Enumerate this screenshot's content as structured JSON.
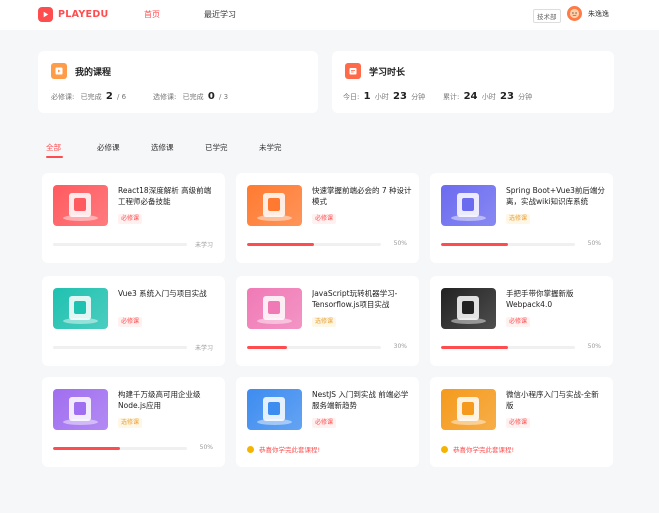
{
  "header": {
    "brand": "PLAYEDU",
    "nav": [
      {
        "label": "首页",
        "active": true
      },
      {
        "label": "最近学习",
        "active": false
      }
    ],
    "department": "技术部",
    "username": "朱逸逸"
  },
  "stats": {
    "my_courses": {
      "title": "我的课程",
      "required_label": "必修课:",
      "required_done_label": "已完成",
      "required_done": "2",
      "required_total": "/ 6",
      "elective_label": "选修课:",
      "elective_done_label": "已完成",
      "elective_done": "0",
      "elective_total": "/ 3"
    },
    "study_time": {
      "title": "学习时长",
      "today_label": "今日:",
      "today_hours": "1",
      "today_minutes": "23",
      "total_label": "累计:",
      "total_hours": "24",
      "total_minutes": "23",
      "hour_unit": "小时",
      "minute_unit": "分钟"
    }
  },
  "tabs": [
    {
      "label": "全部",
      "active": true
    },
    {
      "label": "必修课",
      "active": false
    },
    {
      "label": "选修课",
      "active": false
    },
    {
      "label": "已学完",
      "active": false
    },
    {
      "label": "未学完",
      "active": false
    }
  ],
  "courses": [
    {
      "title": "React18深度解析 高级前端工程师必备技能",
      "tag": "必修课",
      "tag_type": "req",
      "progress": 0,
      "status": "未学习",
      "color": "#ff5a5f"
    },
    {
      "title": "快速掌握前端必会的 7 种设计模式",
      "tag": "必修课",
      "tag_type": "req",
      "progress": 0.5,
      "status": "50%",
      "color": "#ff7a30"
    },
    {
      "title": "Spring Boot+Vue3前后端分离，实战wiki知识库系统",
      "tag": "选修课",
      "tag_type": "opt",
      "progress": 0.5,
      "status": "50%",
      "color": "#6b6bf0"
    },
    {
      "title": "Vue3 系统入门与项目实战",
      "tag": "必修课",
      "tag_type": "req",
      "progress": 0,
      "status": "未学习",
      "color": "#1fc1b0"
    },
    {
      "title": "JavaScript玩转机器学习-Tensorflow.js项目实战",
      "tag": "选修课",
      "tag_type": "opt",
      "progress": 0.3,
      "status": "30%",
      "color": "#f07ab6"
    },
    {
      "title": "手把手带你掌握新版Webpack4.0",
      "tag": "必修课",
      "tag_type": "req",
      "progress": 0.5,
      "status": "50%",
      "color": "#222222"
    },
    {
      "title": "构建千万级高可用企业级Node.js应用",
      "tag": "选修课",
      "tag_type": "opt",
      "progress": 0.5,
      "status": "50%",
      "color": "#a06ef0"
    },
    {
      "title": "NestJS 入门到实战 前端必学服务端新趋势",
      "tag": "必修课",
      "tag_type": "req",
      "progress": 1,
      "status": "恭喜你学完此套课程!",
      "color": "#3d8cf0"
    },
    {
      "title": "微信小程序入门与实战-全新版",
      "tag": "必修课",
      "tag_type": "req",
      "progress": 1,
      "status": "恭喜你学完此套课程!",
      "color": "#f59a1c"
    }
  ]
}
